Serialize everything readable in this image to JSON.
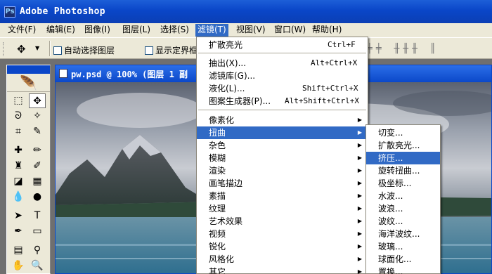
{
  "app": {
    "title": "Adobe Photoshop",
    "icon": "ps-logo-icon"
  },
  "menubar": {
    "items": [
      "文件(F)",
      "编辑(E)",
      "图像(I)",
      "图层(L)",
      "选择(S)",
      "滤镜(T)",
      "视图(V)",
      "窗口(W)",
      "帮助(H)"
    ],
    "active": "滤镜(T)"
  },
  "options": {
    "auto_select_layer": "自动选择图层",
    "show_bounding_box": "显示定界框"
  },
  "document": {
    "title": "pw.psd @ 100% (图层 1 副"
  },
  "filter_menu": {
    "items": [
      {
        "label": "扩散亮光",
        "shortcut": "Ctrl+F"
      },
      {
        "label": "抽出(X)...",
        "shortcut": "Alt+Ctrl+X"
      },
      {
        "label": "滤镜库(G)...",
        "shortcut": ""
      },
      {
        "label": "液化(L)...",
        "shortcut": "Shift+Ctrl+X"
      },
      {
        "label": "图案生成器(P)...",
        "shortcut": "Alt+Shift+Ctrl+X"
      },
      {
        "label": "像素化",
        "submenu": true
      },
      {
        "label": "扭曲",
        "submenu": true,
        "highlighted": true
      },
      {
        "label": "杂色",
        "submenu": true
      },
      {
        "label": "模糊",
        "submenu": true
      },
      {
        "label": "渲染",
        "submenu": true
      },
      {
        "label": "画笔描边",
        "submenu": true
      },
      {
        "label": "素描",
        "submenu": true
      },
      {
        "label": "纹理",
        "submenu": true
      },
      {
        "label": "艺术效果",
        "submenu": true
      },
      {
        "label": "视频",
        "submenu": true
      },
      {
        "label": "锐化",
        "submenu": true
      },
      {
        "label": "风格化",
        "submenu": true
      },
      {
        "label": "其它",
        "submenu": true
      }
    ]
  },
  "distort_submenu": {
    "items": [
      {
        "label": "切变..."
      },
      {
        "label": "扩散亮光..."
      },
      {
        "label": "挤压...",
        "highlighted": true
      },
      {
        "label": "旋转扭曲..."
      },
      {
        "label": "极坐标..."
      },
      {
        "label": "水波..."
      },
      {
        "label": "波浪..."
      },
      {
        "label": "波纹..."
      },
      {
        "label": "海洋波纹..."
      },
      {
        "label": "玻璃..."
      },
      {
        "label": "球面化..."
      },
      {
        "label": "置换..."
      }
    ]
  },
  "colors": {
    "highlight": "#316ac5",
    "titlebar": "#0a46c8",
    "menubar": "#ece9d8"
  }
}
